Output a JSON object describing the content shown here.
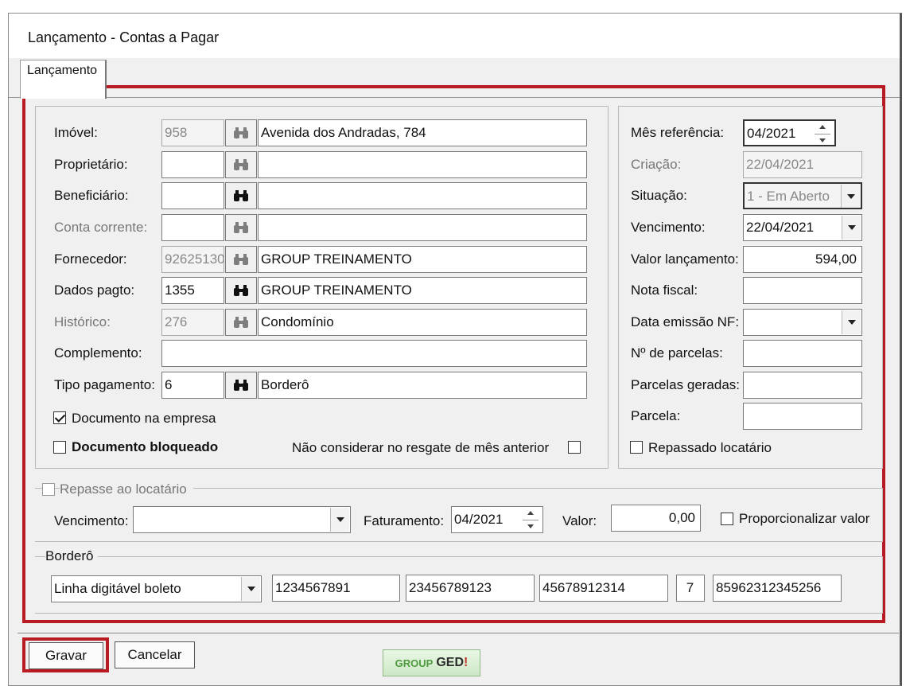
{
  "window": {
    "title": "Lançamento - Contas a Pagar"
  },
  "tabs": [
    {
      "label": "Lançamento"
    }
  ],
  "left": {
    "imovel": {
      "label": "Imóvel:",
      "code": "958",
      "desc": "Avenida dos Andradas, 784"
    },
    "proprietario": {
      "label": "Proprietário:",
      "code": "",
      "desc": ""
    },
    "beneficiario": {
      "label": "Beneficiário:",
      "code": "",
      "desc": ""
    },
    "conta_corrente": {
      "label": "Conta corrente:",
      "code": "",
      "desc": ""
    },
    "fornecedor": {
      "label": "Fornecedor:",
      "code": "92625130",
      "desc": "GROUP TREINAMENTO"
    },
    "dados_pagto": {
      "label": "Dados pagto:",
      "code": "1355",
      "desc": "GROUP TREINAMENTO"
    },
    "historico": {
      "label": "Histórico:",
      "code": "276",
      "desc": "Condomínio"
    },
    "complemento": {
      "label": "Complemento:",
      "value": ""
    },
    "tipo_pagamento": {
      "label": "Tipo pagamento:",
      "code": "6",
      "desc": "Borderô"
    },
    "doc_empresa": {
      "label": "Documento na empresa",
      "checked": true
    },
    "doc_bloqueado": {
      "label": "Documento bloqueado",
      "checked": false
    },
    "nao_considerar": {
      "label": "Não considerar no resgate de mês anterior",
      "checked": false
    }
  },
  "right": {
    "mes_referencia": {
      "label": "Mês referência:",
      "value": "04/2021"
    },
    "criacao": {
      "label": "Criação:",
      "value": "22/04/2021"
    },
    "situacao": {
      "label": "Situação:",
      "value": "1 - Em Aberto"
    },
    "vencimento": {
      "label": "Vencimento:",
      "value": "22/04/2021"
    },
    "valor_lancamento": {
      "label": "Valor lançamento:",
      "value": "594,00"
    },
    "nota_fiscal": {
      "label": "Nota fiscal:",
      "value": ""
    },
    "data_emissao_nf": {
      "label": "Data emissão NF:",
      "value": ""
    },
    "num_parcelas": {
      "label": "Nº de parcelas:",
      "value": ""
    },
    "parcelas_geradas": {
      "label": "Parcelas geradas:",
      "value": ""
    },
    "parcela": {
      "label": "Parcela:",
      "value": ""
    },
    "repassado_locatario": {
      "label": "Repassado locatário",
      "checked": false
    }
  },
  "repasse": {
    "title": "Repasse ao locatário",
    "checked": false,
    "vencimento": {
      "label": "Vencimento:",
      "value": ""
    },
    "faturamento": {
      "label": "Faturamento:",
      "value": "04/2021"
    },
    "valor": {
      "label": "Valor:",
      "value": "0,00"
    },
    "proporcionalizar": {
      "label": "Proporcionalizar valor",
      "checked": false
    }
  },
  "bordero": {
    "title": "Borderô",
    "tipo": "Linha digitável boleto",
    "fields": [
      "1234567891",
      "23456789123",
      "45678912314",
      "7",
      "85962312345256"
    ]
  },
  "buttons": {
    "gravar": "Gravar",
    "cancelar": "Cancelar"
  },
  "logo": {
    "part1": "GROUP",
    "part2": "GED",
    "mark": "!"
  },
  "colors": {
    "highlight": "#b81c22",
    "logo_green": "#4e9a3e"
  },
  "icons": {
    "find": "binoculars-icon"
  }
}
